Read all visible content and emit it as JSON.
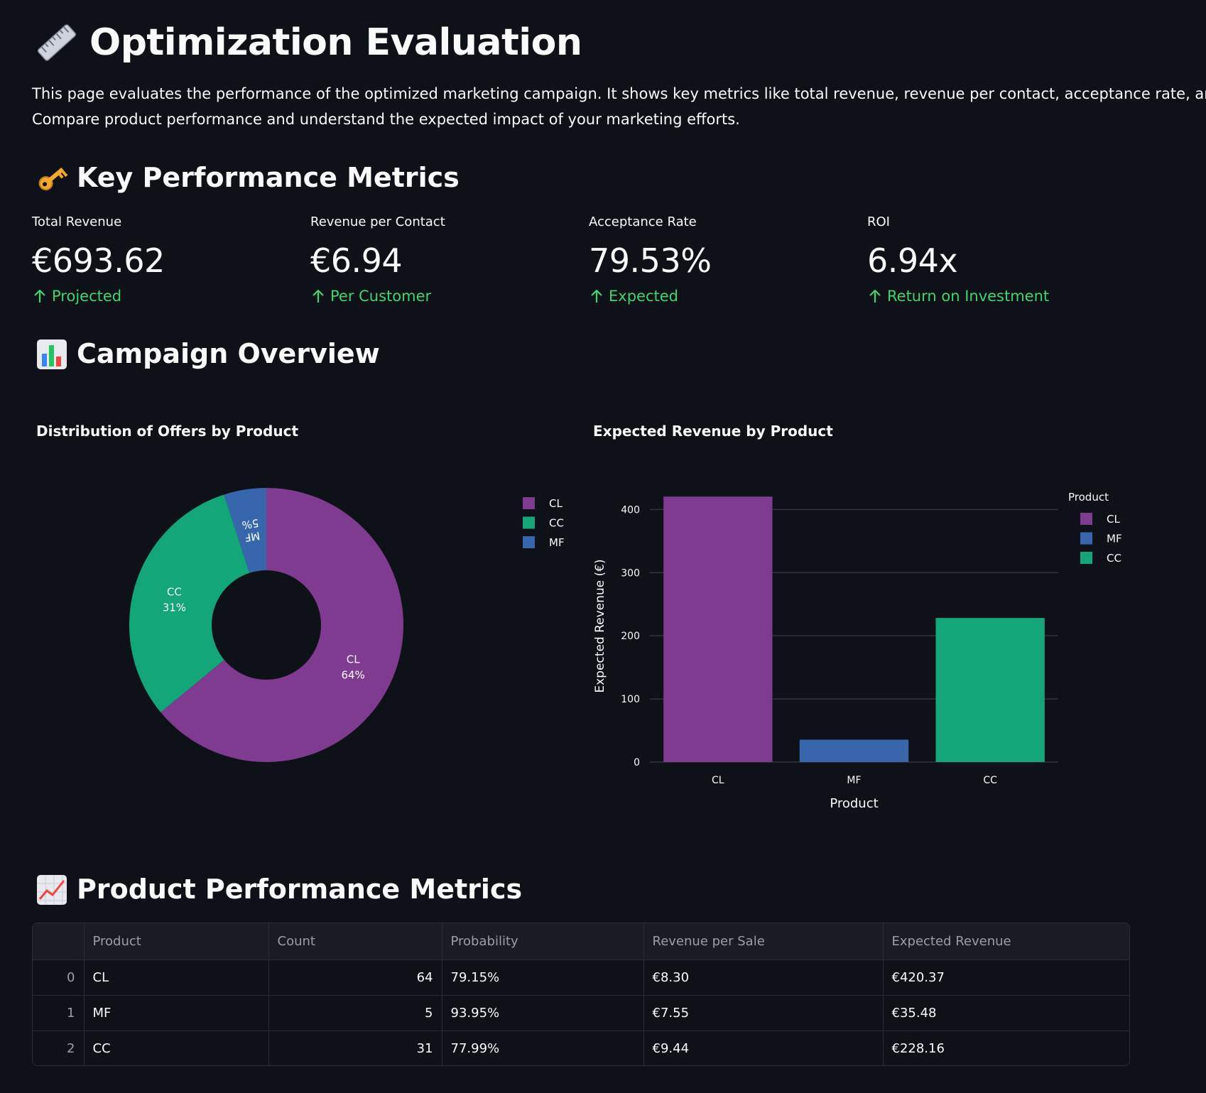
{
  "title": "Optimization Evaluation",
  "title_icon": "ruler-icon",
  "intro": {
    "line1": "This page evaluates the performance of the optimized marketing campaign. It shows key metrics like total revenue, revenue per contact, acceptance rate, and ROI.",
    "line2": "Compare product performance and understand the expected impact of your marketing efforts."
  },
  "kpi_section": {
    "title": "Key Performance Metrics",
    "icon": "key-icon",
    "metrics": [
      {
        "label": "Total Revenue",
        "value": "€693.62",
        "delta": "Projected"
      },
      {
        "label": "Revenue per Contact",
        "value": "€6.94",
        "delta": "Per Customer"
      },
      {
        "label": "Acceptance Rate",
        "value": "79.53%",
        "delta": "Expected"
      },
      {
        "label": "ROI",
        "value": "6.94x",
        "delta": "Return on Investment"
      }
    ]
  },
  "overview_section": {
    "title": "Campaign Overview",
    "icon": "bar-chart-icon"
  },
  "colors": {
    "CL": "#7e3b8f",
    "CC": "#12a679",
    "MF": "#3766ad",
    "delta": "#3dd56d",
    "background": "#0e1117"
  },
  "chart_data": [
    {
      "type": "pie",
      "title": "Distribution of Offers by Product",
      "labels": [
        "CL",
        "CC",
        "MF"
      ],
      "values": [
        64,
        31,
        5
      ],
      "percent_labels": [
        "64%",
        "31%",
        "5%"
      ],
      "hole": true,
      "legend_position": "top-right"
    },
    {
      "type": "bar",
      "title": "Expected Revenue by Product",
      "categories": [
        "CL",
        "MF",
        "CC"
      ],
      "values": [
        420.37,
        35.48,
        228.16
      ],
      "xlabel": "Product",
      "ylabel": "Expected Revenue (€)",
      "yticks": [
        0,
        100,
        200,
        300,
        400
      ],
      "ylim": [
        0,
        442
      ],
      "legend_title": "Product",
      "legend_position": "top-right",
      "grid": true
    }
  ],
  "product_section": {
    "title": "Product Performance Metrics",
    "icon": "chart-increasing-icon"
  },
  "table": {
    "columns": [
      "",
      "Product",
      "Count",
      "Probability",
      "Revenue per Sale",
      "Expected Revenue"
    ],
    "rows": [
      [
        "0",
        "CL",
        "64",
        "79.15%",
        "€8.30",
        "€420.37"
      ],
      [
        "1",
        "MF",
        "5",
        "93.95%",
        "€7.55",
        "€35.48"
      ],
      [
        "2",
        "CC",
        "31",
        "77.99%",
        "€9.44",
        "€228.16"
      ]
    ]
  }
}
